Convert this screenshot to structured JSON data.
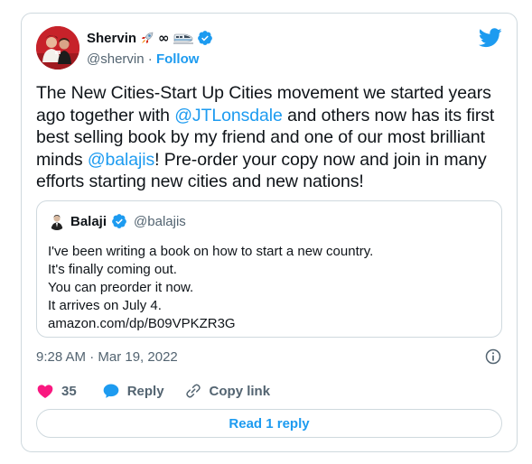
{
  "author": {
    "name": "Shervin",
    "name_emojis": [
      "rocket-emoji",
      "infinity-emoji",
      "bullet-train-emoji"
    ],
    "infinity_glyph": "∞",
    "handle": "@shervin",
    "separator": "·",
    "follow_label": "Follow"
  },
  "tweet": {
    "segments": [
      {
        "text": "The New Cities-Start Up Cities movement we started years ago together with ",
        "type": "text"
      },
      {
        "text": "@JTLonsdale",
        "type": "mention"
      },
      {
        "text": " and others now has its first best selling book by my friend and one of our most brilliant minds ",
        "type": "text"
      },
      {
        "text": "@balajis",
        "type": "mention"
      },
      {
        "text": "! Pre-order your copy now and join in many efforts starting new cities and new nations!",
        "type": "text"
      }
    ]
  },
  "quoted_tweet": {
    "name": "Balaji",
    "handle": "@balajis",
    "lines": [
      "I've been writing a book on how to start a new country.",
      "It's finally coming out.",
      "You can preorder it now.",
      "It arrives on July 4.",
      "amazon.com/dp/B09VPKZR3G"
    ]
  },
  "timestamp": "9:28 AM · Mar 19, 2022",
  "actions": {
    "like_count": "35",
    "reply_label": "Reply",
    "copy_link_label": "Copy link"
  },
  "read_replies_label": "Read 1 reply",
  "colors": {
    "accent": "#1d9bf0",
    "like": "#f91880",
    "text": "#0f1419",
    "secondary": "#536471",
    "border": "#cfd9de"
  },
  "icons": [
    "twitter-bird-icon",
    "verified-badge-icon",
    "info-icon",
    "heart-icon",
    "reply-bubble-icon",
    "link-icon"
  ]
}
